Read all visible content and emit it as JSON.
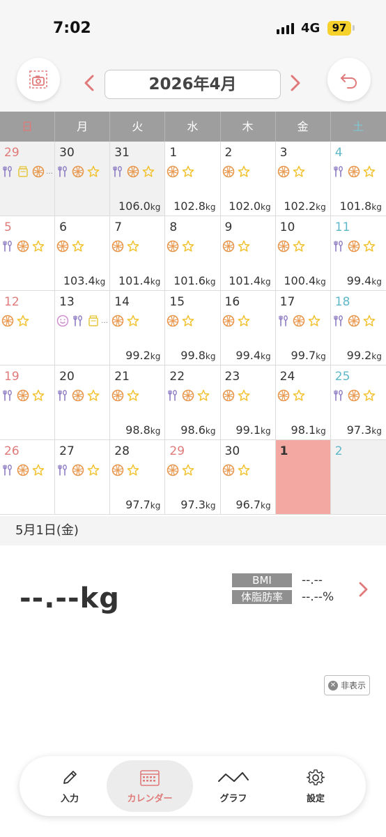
{
  "status_bar": {
    "time": "7:02",
    "network": "4G",
    "battery": "97"
  },
  "header": {
    "month_title": "2026年4月",
    "prev_label": "‹",
    "next_label": "›"
  },
  "weekdays": [
    "日",
    "月",
    "火",
    "水",
    "木",
    "金",
    "土"
  ],
  "colors": {
    "accent": "#e07a7a",
    "saturday": "#5fb8c9",
    "selected_day": "#f3a9a2",
    "weekday_header": "#9e9e9e"
  },
  "weeks": [
    {
      "days": [
        {
          "day": "29",
          "other": true,
          "icons": [
            "fork-spoon",
            "jar",
            "ball"
          ],
          "more": "…",
          "weight": ""
        },
        {
          "day": "30",
          "other": true,
          "icons": [
            "fork-spoon",
            "ball",
            "star"
          ],
          "weight": ""
        },
        {
          "day": "31",
          "other": true,
          "icons": [
            "fork-spoon",
            "ball",
            "star"
          ],
          "weight": "106.0"
        },
        {
          "day": "1",
          "icons": [
            "ball",
            "star"
          ],
          "weight": "102.8"
        },
        {
          "day": "2",
          "icons": [
            "ball",
            "star"
          ],
          "weight": "102.0"
        },
        {
          "day": "3",
          "icons": [
            "ball",
            "star"
          ],
          "weight": "102.2"
        },
        {
          "day": "4",
          "icons": [
            "fork-spoon",
            "ball",
            "star"
          ],
          "weight": "101.8"
        }
      ]
    },
    {
      "days": [
        {
          "day": "5",
          "icons": [
            "fork-spoon",
            "ball",
            "star"
          ],
          "weight": ""
        },
        {
          "day": "6",
          "icons": [
            "ball",
            "star"
          ],
          "weight": "103.4"
        },
        {
          "day": "7",
          "icons": [
            "ball",
            "star"
          ],
          "weight": "101.4"
        },
        {
          "day": "8",
          "icons": [
            "ball",
            "star"
          ],
          "weight": "101.6"
        },
        {
          "day": "9",
          "icons": [
            "ball",
            "star"
          ],
          "weight": "101.4"
        },
        {
          "day": "10",
          "icons": [
            "ball",
            "star"
          ],
          "weight": "100.4"
        },
        {
          "day": "11",
          "icons": [
            "fork-spoon",
            "ball",
            "star"
          ],
          "weight": "99.4"
        }
      ]
    },
    {
      "days": [
        {
          "day": "12",
          "icons": [
            "ball",
            "star"
          ],
          "weight": ""
        },
        {
          "day": "13",
          "icons": [
            "smiley",
            "fork-spoon",
            "jar"
          ],
          "more": "…",
          "weight": ""
        },
        {
          "day": "14",
          "icons": [
            "ball",
            "star"
          ],
          "weight": "99.2"
        },
        {
          "day": "15",
          "icons": [
            "ball",
            "star"
          ],
          "weight": "99.8"
        },
        {
          "day": "16",
          "icons": [
            "ball",
            "star"
          ],
          "weight": "99.4"
        },
        {
          "day": "17",
          "icons": [
            "fork-spoon",
            "ball",
            "star"
          ],
          "weight": "99.7"
        },
        {
          "day": "18",
          "icons": [
            "fork-spoon",
            "ball",
            "star"
          ],
          "weight": "99.2"
        }
      ]
    },
    {
      "days": [
        {
          "day": "19",
          "icons": [
            "fork-spoon",
            "ball",
            "star"
          ],
          "weight": ""
        },
        {
          "day": "20",
          "icons": [
            "fork-spoon",
            "ball",
            "star"
          ],
          "weight": ""
        },
        {
          "day": "21",
          "icons": [
            "ball",
            "star"
          ],
          "weight": "98.8"
        },
        {
          "day": "22",
          "icons": [
            "fork-spoon",
            "ball",
            "star"
          ],
          "weight": "98.6"
        },
        {
          "day": "23",
          "icons": [
            "ball",
            "star"
          ],
          "weight": "99.1"
        },
        {
          "day": "24",
          "icons": [
            "ball",
            "star"
          ],
          "weight": "98.1"
        },
        {
          "day": "25",
          "icons": [
            "fork-spoon",
            "ball",
            "star"
          ],
          "weight": "97.3"
        }
      ]
    },
    {
      "days": [
        {
          "day": "26",
          "icons": [
            "fork-spoon",
            "ball",
            "star"
          ],
          "weight": ""
        },
        {
          "day": "27",
          "icons": [
            "fork-spoon",
            "ball",
            "star"
          ],
          "weight": ""
        },
        {
          "day": "28",
          "icons": [
            "ball",
            "star"
          ],
          "weight": "97.7"
        },
        {
          "day": "29",
          "sunday_color": true,
          "icons": [
            "ball",
            "star"
          ],
          "weight": "97.3"
        },
        {
          "day": "30",
          "icons": [
            "ball",
            "star"
          ],
          "weight": "96.7"
        },
        {
          "day": "1",
          "selected": true,
          "other": true,
          "icons": [],
          "weight": ""
        },
        {
          "day": "2",
          "other": true,
          "icons": [],
          "weight": ""
        }
      ]
    }
  ],
  "weight_unit": "kg",
  "selected": {
    "date_label": "5月1日(金)",
    "weight": "--.--",
    "weight_unit": "kg",
    "bmi_label": "BMI",
    "bmi_value": "--.--",
    "fat_label": "体脂肪率",
    "fat_value": "--.--%"
  },
  "hide_button": {
    "label": "非表示"
  },
  "tabs": [
    {
      "label": "入力",
      "icon": "pencil-icon"
    },
    {
      "label": "カレンダー",
      "icon": "calendar-icon",
      "active": true
    },
    {
      "label": "グラフ",
      "icon": "graph-icon"
    },
    {
      "label": "設定",
      "icon": "gear-icon"
    }
  ]
}
